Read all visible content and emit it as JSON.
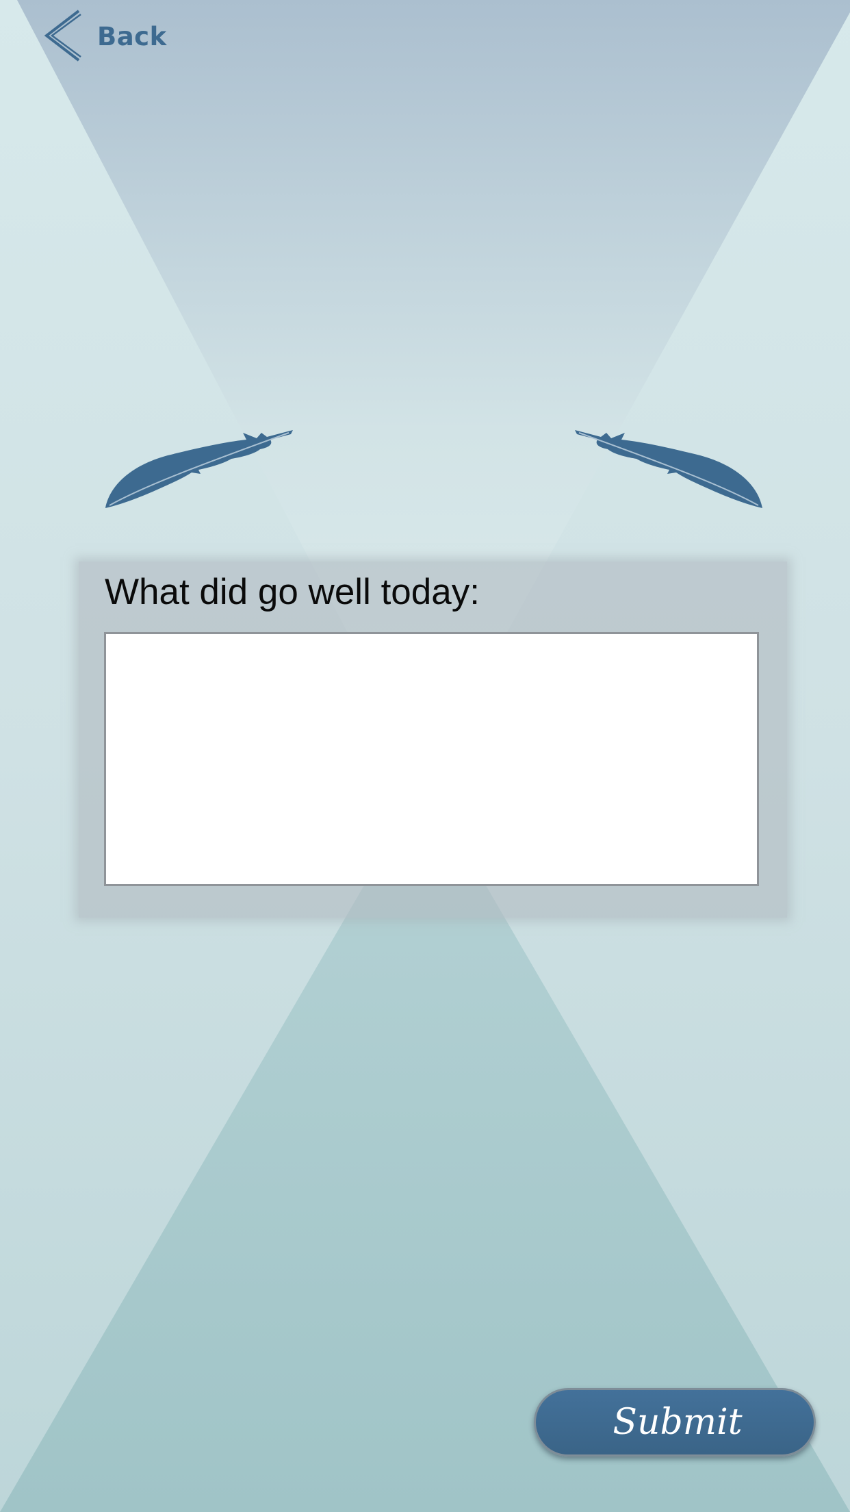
{
  "nav": {
    "back_label": "Back",
    "back_icon": "chevron-left-icon"
  },
  "decoration": {
    "left_icon": "feather-icon",
    "right_icon": "feather-icon"
  },
  "form": {
    "question_label": "What did go well today:",
    "answer_value": "",
    "submit_label": "Submit"
  },
  "colors": {
    "accent": "#3d6a90",
    "background_light": "#d4e6e8",
    "background_top": "#adc1d0",
    "background_bottom": "#a3c6c9",
    "card": "#b8c2c7"
  }
}
